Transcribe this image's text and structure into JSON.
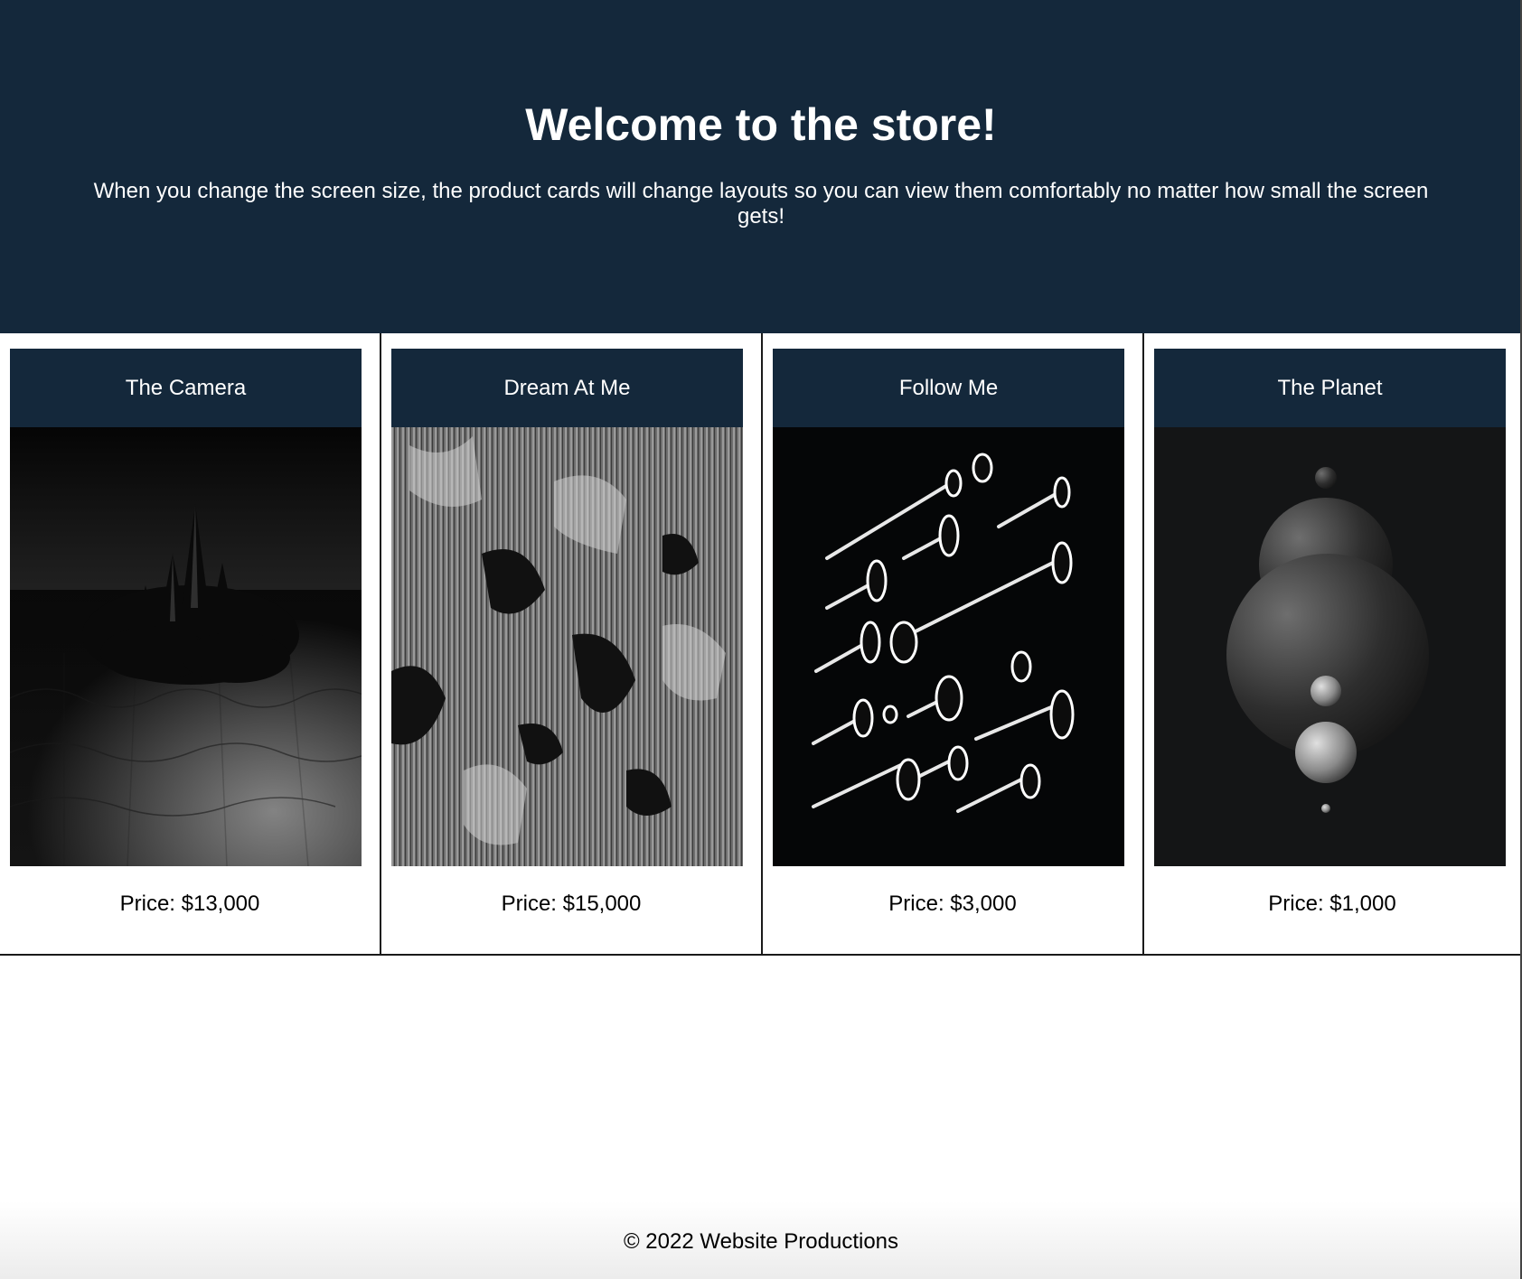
{
  "hero": {
    "title": "Welcome to the store!",
    "subtitle": "When you change the screen size, the product cards will change layouts so you can view them comfortably no matter how small the screen gets!"
  },
  "products": [
    {
      "title": "The Camera",
      "price": "Price: $13,000"
    },
    {
      "title": "Dream At Me",
      "price": "Price: $15,000"
    },
    {
      "title": "Follow Me",
      "price": "Price: $3,000"
    },
    {
      "title": "The Planet",
      "price": "Price: $1,000"
    }
  ],
  "footer": {
    "copyright": "© 2022 Website Productions"
  },
  "colors": {
    "header_bg": "#14283b",
    "text_light": "#ffffff"
  }
}
